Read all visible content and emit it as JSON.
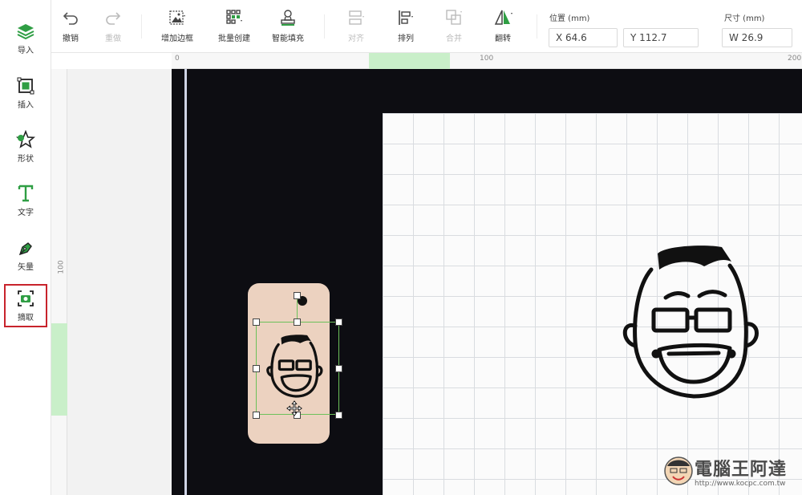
{
  "sidebar": {
    "items": [
      {
        "label": "导入",
        "icon": "layers-icon"
      },
      {
        "label": "插入",
        "icon": "insert-image-icon"
      },
      {
        "label": "形状",
        "icon": "shape-icon"
      },
      {
        "label": "文字",
        "icon": "text-icon"
      },
      {
        "label": "矢量",
        "icon": "pen-icon"
      },
      {
        "label": "摘取",
        "icon": "capture-icon",
        "active": true
      }
    ]
  },
  "toolbar": {
    "undo": "撤销",
    "redo": "重做",
    "add_border": "增加边框",
    "batch_create": "批量创建",
    "smart_fill": "智能填充",
    "align": "对齐",
    "arrange": "排列",
    "merge": "合并",
    "flip": "翻转"
  },
  "position": {
    "title": "位置 (mm)",
    "x": "X 64.6",
    "y": "Y 112.7"
  },
  "size": {
    "title": "尺寸 (mm)",
    "w": "W 26.9"
  },
  "ruler": {
    "top_0": "0",
    "top_100": "100",
    "top_200": "200",
    "left_100": "100"
  },
  "watermark": {
    "title": "電腦王阿達",
    "url": "http://www.kocpc.com.tw"
  },
  "colors": {
    "accent_green": "#6cc15a",
    "active_border": "#c8232c",
    "workspace": "#0d0d12"
  }
}
